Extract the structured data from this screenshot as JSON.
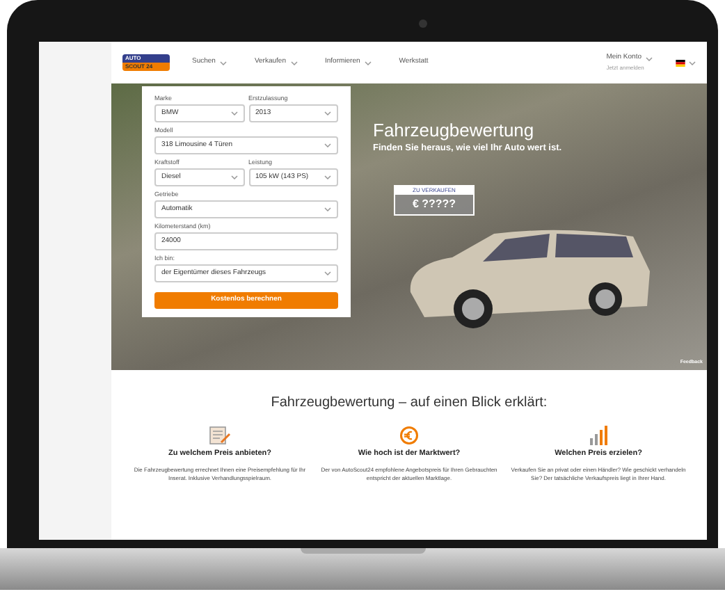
{
  "header": {
    "logo": {
      "line_1": "AUTO",
      "line_2": "SCOUT 24"
    },
    "nav": [
      {
        "label": "Suchen",
        "dropdown": true
      },
      {
        "label": "Verkaufen",
        "dropdown": true
      },
      {
        "label": "Informieren",
        "dropdown": true
      },
      {
        "label": "Werkstatt",
        "dropdown": false
      }
    ],
    "account": {
      "label": "Mein Konto",
      "sublabel": "Jetzt anmelden"
    }
  },
  "form": {
    "rows": [
      [
        {
          "kind": "select",
          "label": "Marke",
          "value": "BMW"
        },
        {
          "kind": "select",
          "label": "Erstzulassung",
          "value": "2013"
        }
      ],
      [
        {
          "kind": "select",
          "label": "Modell",
          "value": "318 Limousine 4 Türen"
        }
      ],
      [
        {
          "kind": "select",
          "label": "Kraftstoff",
          "value": "Diesel"
        },
        {
          "kind": "select",
          "label": "Leistung",
          "value": "105 kW (143 PS)"
        }
      ],
      [
        {
          "kind": "select",
          "label": "Getriebe",
          "value": "Automatik"
        }
      ],
      [
        {
          "kind": "input",
          "label": "Kilometerstand (km)",
          "value": "24000"
        }
      ],
      [
        {
          "kind": "select",
          "label": "Ich bin:",
          "value": "der Eigentümer dieses Fahrzeugs"
        }
      ]
    ],
    "submit": "Kostenlos berechnen"
  },
  "hero": {
    "title": "Fahrzeugbewertung",
    "subtitle": "Finden Sie heraus, wie viel Ihr Auto wert ist.",
    "price_tag": {
      "label": "ZU VERKAUFEN",
      "value": "€ ?????"
    },
    "feedback": "Feedback"
  },
  "explainer": {
    "heading": "Fahrzeugbewertung – auf einen Blick erklärt:",
    "features": [
      {
        "kind": "document",
        "title": "Zu welchem Preis anbieten?",
        "text": "Die Fahrzeugbewertung errechnet Ihnen eine Preisempfehlung für Ihr Inserat. Inklusive Verhandlungsspielraum."
      },
      {
        "kind": "euro",
        "title": "Wie hoch ist der Marktwert?",
        "text": "Der von AutoScout24 empfohlene Angebotspreis für Ihren Gebrauchten entspricht der aktuellen Marktlage."
      },
      {
        "kind": "bars",
        "title": "Welchen Preis erzielen?",
        "text": "Verkaufen Sie an privat oder einen Händler? Wie geschickt verhandeln Sie? Der tatsächliche Verkaufspreis liegt in Ihrer Hand."
      }
    ]
  }
}
